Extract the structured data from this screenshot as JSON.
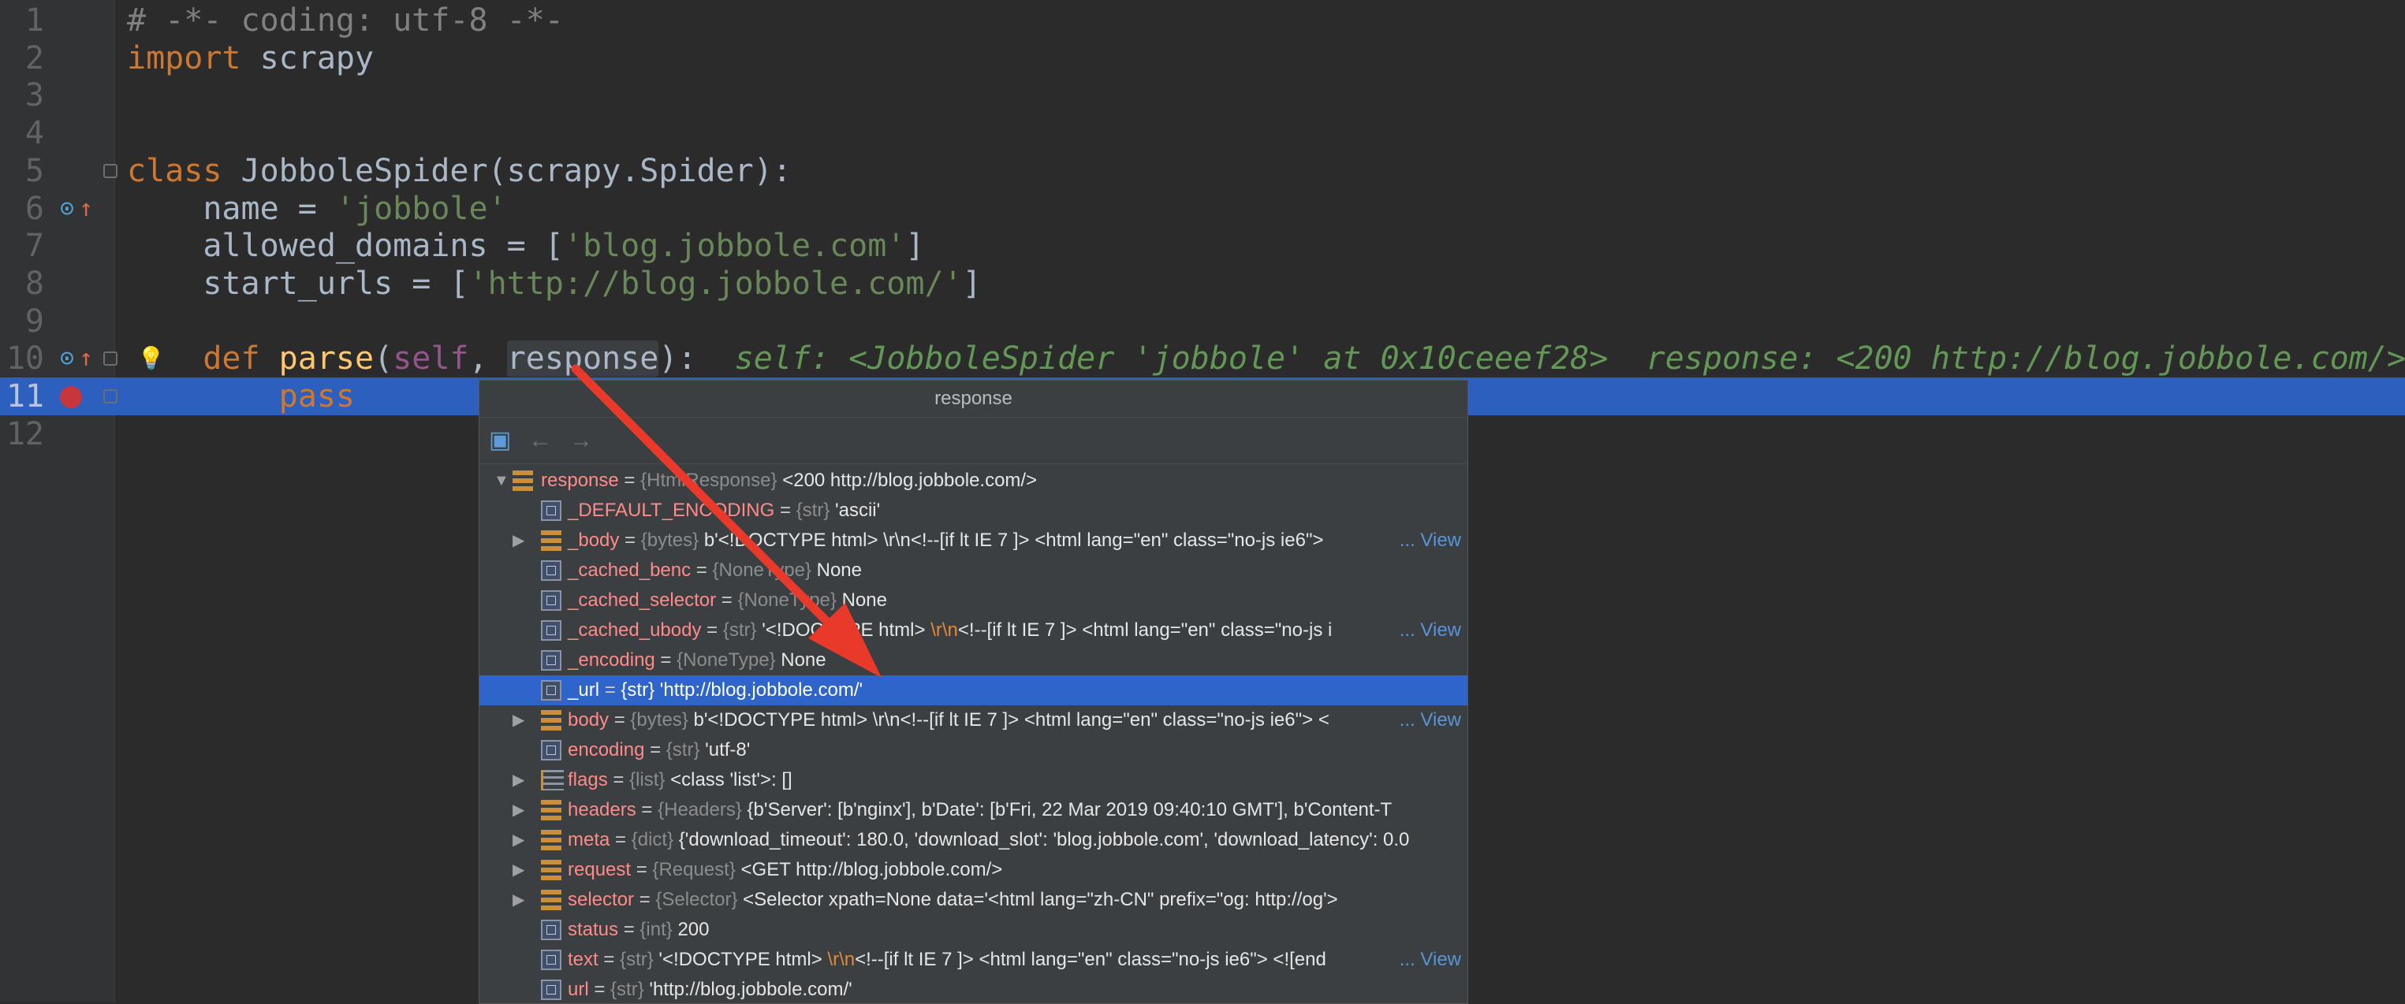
{
  "editor": {
    "lines": [
      {
        "num": "1",
        "parts": [
          {
            "t": "# -*- coding: utf-8 -*-",
            "c": "cmt"
          }
        ]
      },
      {
        "num": "2",
        "parts": [
          {
            "t": "import",
            "c": "kw"
          },
          {
            "t": " scrapy",
            "c": ""
          }
        ]
      },
      {
        "num": "3",
        "parts": []
      },
      {
        "num": "4",
        "parts": []
      },
      {
        "num": "5",
        "parts": [
          {
            "t": "class",
            "c": "kw"
          },
          {
            "t": " JobboleSpider(scrapy.Spider):",
            "c": ""
          }
        ]
      },
      {
        "num": "6",
        "parts": [
          {
            "t": "    name = ",
            "c": ""
          },
          {
            "t": "'jobbole'",
            "c": "str"
          }
        ]
      },
      {
        "num": "7",
        "parts": [
          {
            "t": "    allowed_domains = [",
            "c": ""
          },
          {
            "t": "'blog.jobbole.com'",
            "c": "str"
          },
          {
            "t": "]",
            "c": ""
          }
        ]
      },
      {
        "num": "8",
        "parts": [
          {
            "t": "    start_urls = [",
            "c": ""
          },
          {
            "t": "'http://blog.jobbole.com/'",
            "c": "str"
          },
          {
            "t": "]",
            "c": ""
          }
        ]
      },
      {
        "num": "9",
        "parts": []
      },
      {
        "num": "10",
        "parts": [
          {
            "t": "    ",
            "c": ""
          },
          {
            "t": "def",
            "c": "kw"
          },
          {
            "t": " ",
            "c": ""
          },
          {
            "t": "parse",
            "c": "fn"
          },
          {
            "t": "(",
            "c": ""
          },
          {
            "t": "self",
            "c": "self"
          },
          {
            "t": ", ",
            "c": ""
          },
          {
            "t": "response",
            "c": "param-hl"
          },
          {
            "t": "):",
            "c": ""
          },
          {
            "t": "  self: <JobboleSpider 'jobbole' at 0x10ceeef28>  response: <200 http://blog.jobbole.com/>",
            "c": "inlay"
          }
        ]
      },
      {
        "num": "11",
        "parts": [
          {
            "t": "        ",
            "c": ""
          },
          {
            "t": "pass",
            "c": "kw"
          }
        ]
      },
      {
        "num": "12",
        "parts": []
      }
    ]
  },
  "popup": {
    "title": "response",
    "rows": [
      {
        "expander": "▼",
        "icon": "bars",
        "top": true,
        "name": "response",
        "type": "{HtmlResponse}",
        "value": "<200 http://blog.jobbole.com/>",
        "view": ""
      },
      {
        "expander": "",
        "icon": "prim",
        "name": "_DEFAULT_ENCODING",
        "type": "{str}",
        "value": "'ascii'",
        "view": ""
      },
      {
        "expander": "▶",
        "icon": "bars",
        "name": "_body",
        "type": "{bytes}",
        "value": "b'<!DOCTYPE html>  \\r\\n<!--[if lt IE 7 ]> <html lang=\"en\" class=\"no-js ie6\">",
        "view": "... View"
      },
      {
        "expander": "",
        "icon": "prim",
        "name": "_cached_benc",
        "type": "{NoneType}",
        "value": "None",
        "view": ""
      },
      {
        "expander": "",
        "icon": "prim",
        "name": "_cached_selector",
        "type": "{NoneType}",
        "value": "None",
        "view": ""
      },
      {
        "expander": "",
        "icon": "prim",
        "name": "_cached_ubody",
        "type": "{str}",
        "value": "'<!DOCTYPE html>  ",
        "esc": "\\r\\n",
        "value2": "<!--[if lt IE 7 ]> <html lang=\"en\" class=\"no-js i",
        "view": "... View"
      },
      {
        "expander": "",
        "icon": "prim",
        "name": "_encoding",
        "type": "{NoneType}",
        "value": "None",
        "view": ""
      },
      {
        "expander": "",
        "icon": "prim",
        "selected": true,
        "name": "_url",
        "type": "{str}",
        "value": "'http://blog.jobbole.com/'",
        "view": ""
      },
      {
        "expander": "▶",
        "icon": "bars",
        "name": "body",
        "type": "{bytes}",
        "value": "b'<!DOCTYPE html>  \\r\\n<!--[if lt IE 7 ]> <html lang=\"en\" class=\"no-js ie6\"> <",
        "view": "... View"
      },
      {
        "expander": "",
        "icon": "prim",
        "name": "encoding",
        "type": "{str}",
        "value": "'utf-8'",
        "view": ""
      },
      {
        "expander": "▶",
        "icon": "list",
        "name": "flags",
        "type": "{list}",
        "value": "<class 'list'>: []",
        "view": ""
      },
      {
        "expander": "▶",
        "icon": "bars",
        "name": "headers",
        "type": "{Headers}",
        "value": "{b'Server': [b'nginx'], b'Date': [b'Fri, 22 Mar 2019 09:40:10 GMT'], b'Content-T",
        "view": ""
      },
      {
        "expander": "▶",
        "icon": "bars",
        "name": "meta",
        "type": "{dict}",
        "value": "{'download_timeout': 180.0, 'download_slot': 'blog.jobbole.com', 'download_latency': 0.0",
        "view": ""
      },
      {
        "expander": "▶",
        "icon": "bars",
        "name": "request",
        "type": "{Request}",
        "value": "<GET http://blog.jobbole.com/>",
        "view": ""
      },
      {
        "expander": "▶",
        "icon": "bars",
        "name": "selector",
        "type": "{Selector}",
        "value": "<Selector xpath=None data='<html lang=\"zh-CN\" prefix=\"og: http://og'>",
        "view": ""
      },
      {
        "expander": "",
        "icon": "prim",
        "name": "status",
        "type": "{int}",
        "value": "200",
        "view": ""
      },
      {
        "expander": "",
        "icon": "prim",
        "name": "text",
        "type": "{str}",
        "value": "'<!DOCTYPE html>  ",
        "esc": "\\r\\n",
        "value2": "<!--[if lt IE 7 ]> <html lang=\"en\" class=\"no-js ie6\"> <![end",
        "view": "... View"
      },
      {
        "expander": "",
        "icon": "prim",
        "name": "url",
        "type": "{str}",
        "value": "'http://blog.jobbole.com/'",
        "view": ""
      }
    ]
  },
  "colors": {
    "editor_bg": "#2b2b2b",
    "exec_line": "#2d5fbf",
    "selection": "#2f65ca",
    "breakpoint": "#c7363d",
    "arrow": "#e8392b"
  }
}
